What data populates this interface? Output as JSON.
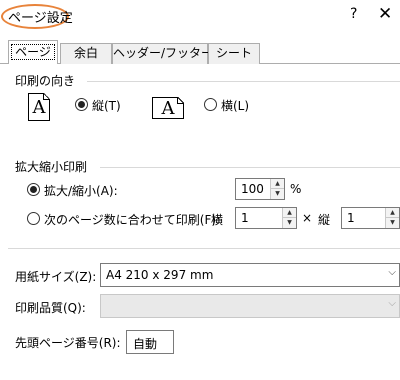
{
  "window": {
    "title": "ページ設定",
    "help_label": "?",
    "close_label": "✕",
    "highlight_color": "#e8833a"
  },
  "tabs": [
    {
      "label": "ページ",
      "active": true
    },
    {
      "label": "余白",
      "active": false
    },
    {
      "label": "ヘッダー/フッター",
      "active": false
    },
    {
      "label": "シート",
      "active": false
    }
  ],
  "orientation": {
    "group_title": "印刷の向き",
    "portrait_label": "縦(T)",
    "portrait_glyph": "A",
    "landscape_label": "横(L)",
    "landscape_glyph": "A",
    "selected": "portrait"
  },
  "scaling": {
    "group_title": "拡大縮小印刷",
    "adjust_label": "拡大/縮小(A):",
    "adjust_value": "100",
    "percent_label": "%",
    "fit_label": "次のページ数に合わせて印刷(F):",
    "wide_label": "横",
    "wide_value": "1",
    "times_label": "×",
    "tall_label": "縦",
    "tall_value": "1",
    "selected": "adjust"
  },
  "paper": {
    "size_label": "用紙サイズ(Z):",
    "size_value": "A4 210 x 297 mm",
    "quality_label": "印刷品質(Q):",
    "quality_value": "",
    "first_page_label": "先頭ページ番号(R):",
    "first_page_value": "自動"
  },
  "icons": {
    "spin_up": "▲",
    "spin_down": "▼",
    "dropdown_arrow": "⌵"
  }
}
